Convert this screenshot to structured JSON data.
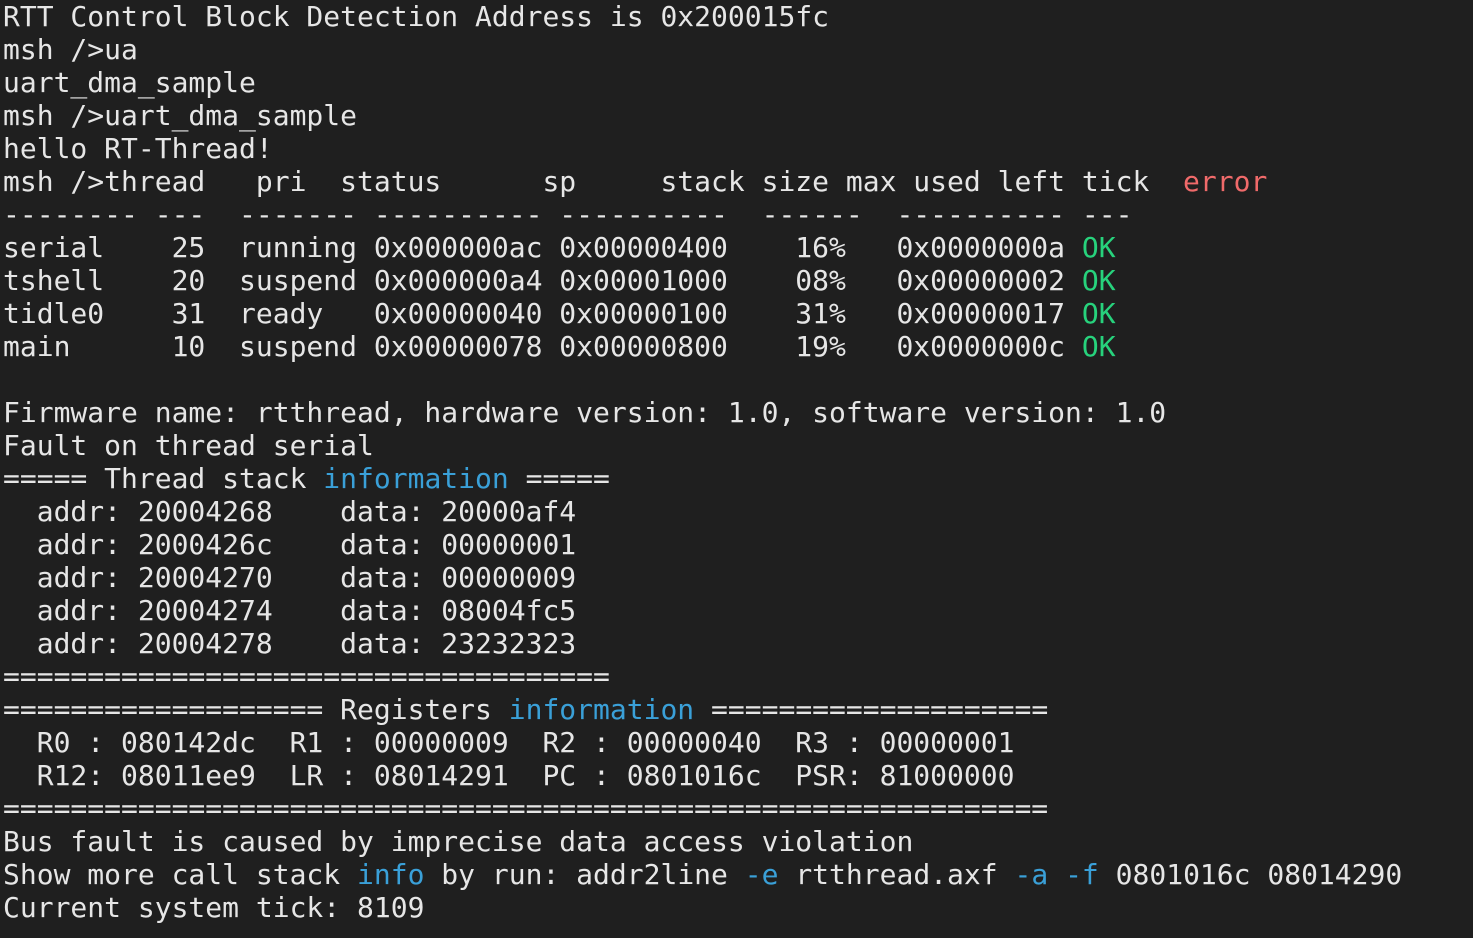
{
  "terminal": {
    "lines": [
      {
        "id": "rtt",
        "segments": [
          {
            "text": "RTT Control Block Detection Address is 0x200015fc",
            "color": "default"
          }
        ]
      },
      {
        "id": "cmd-ua",
        "segments": [
          {
            "text": "msh />ua",
            "color": "default"
          }
        ]
      },
      {
        "id": "complete-uart",
        "segments": [
          {
            "text": "uart_dma_sample",
            "color": "default"
          }
        ]
      },
      {
        "id": "cmd-uart",
        "segments": [
          {
            "text": "msh />uart_dma_sample",
            "color": "default"
          }
        ]
      },
      {
        "id": "hello",
        "segments": [
          {
            "text": "hello RT-Thread!",
            "color": "default"
          }
        ]
      },
      {
        "id": "thread-header",
        "segments": [
          {
            "text": "msh />thread   pri  status      sp     stack size max used left tick  ",
            "color": "default"
          },
          {
            "text": "error",
            "color": "red"
          }
        ]
      },
      {
        "id": "thread-separator",
        "segments": [
          {
            "text": "-------- ---  ------- ---------- ----------  ------  ---------- ---",
            "color": "default"
          }
        ]
      },
      {
        "id": "row-serial",
        "segments": [
          {
            "text": "serial    25  running 0x000000ac 0x00000400    16%   0x0000000a ",
            "color": "default"
          },
          {
            "text": "OK",
            "color": "green"
          }
        ]
      },
      {
        "id": "row-tshell",
        "segments": [
          {
            "text": "tshell    20  suspend 0x000000a4 0x00001000    08%   0x00000002 ",
            "color": "default"
          },
          {
            "text": "OK",
            "color": "green"
          }
        ]
      },
      {
        "id": "row-tidle0",
        "segments": [
          {
            "text": "tidle0    31  ready   0x00000040 0x00000100    31%   0x00000017 ",
            "color": "default"
          },
          {
            "text": "OK",
            "color": "green"
          }
        ]
      },
      {
        "id": "row-main",
        "segments": [
          {
            "text": "main      10  suspend 0x00000078 0x00000800    19%   0x0000000c ",
            "color": "default"
          },
          {
            "text": "OK",
            "color": "green"
          }
        ]
      },
      {
        "id": "blank",
        "segments": [
          {
            "text": "",
            "color": "default"
          }
        ]
      },
      {
        "id": "firmware",
        "segments": [
          {
            "text": "Firmware name: rtthread, hardware version: 1.0, software version: 1.0",
            "color": "default"
          }
        ]
      },
      {
        "id": "fault",
        "segments": [
          {
            "text": "Fault on thread serial",
            "color": "default"
          }
        ]
      },
      {
        "id": "stack-header",
        "segments": [
          {
            "text": "===== Thread stack ",
            "color": "default"
          },
          {
            "text": "information",
            "color": "blue"
          },
          {
            "text": " =====",
            "color": "default"
          }
        ]
      },
      {
        "id": "stack-1",
        "segments": [
          {
            "text": "  addr: 20004268    data: 20000af4",
            "color": "default"
          }
        ]
      },
      {
        "id": "stack-2",
        "segments": [
          {
            "text": "  addr: 2000426c    data: 00000001",
            "color": "default"
          }
        ]
      },
      {
        "id": "stack-3",
        "segments": [
          {
            "text": "  addr: 20004270    data: 00000009",
            "color": "default"
          }
        ]
      },
      {
        "id": "stack-4",
        "segments": [
          {
            "text": "  addr: 20004274    data: 08004fc5",
            "color": "default"
          }
        ]
      },
      {
        "id": "stack-5",
        "segments": [
          {
            "text": "  addr: 20004278    data: 23232323",
            "color": "default"
          }
        ]
      },
      {
        "id": "stack-footer",
        "segments": [
          {
            "text": "====================================",
            "color": "default"
          }
        ]
      },
      {
        "id": "reg-header",
        "segments": [
          {
            "text": "=================== Registers ",
            "color": "default"
          },
          {
            "text": "information",
            "color": "blue"
          },
          {
            "text": " ====================",
            "color": "default"
          }
        ]
      },
      {
        "id": "reg-1",
        "segments": [
          {
            "text": "  R0 : 080142dc  R1 : 00000009  R2 : 00000040  R3 : 00000001",
            "color": "default"
          }
        ]
      },
      {
        "id": "reg-2",
        "segments": [
          {
            "text": "  R12: 08011ee9  LR : 08014291  PC : 0801016c  PSR: 81000000",
            "color": "default"
          }
        ]
      },
      {
        "id": "reg-footer",
        "segments": [
          {
            "text": "==============================================================",
            "color": "default"
          }
        ]
      },
      {
        "id": "bus-fault",
        "segments": [
          {
            "text": "Bus fault is caused by imprecise data access violation",
            "color": "default"
          }
        ]
      },
      {
        "id": "show-more",
        "segments": [
          {
            "text": "Show more call stack ",
            "color": "default"
          },
          {
            "text": "info",
            "color": "blue"
          },
          {
            "text": " by run: addr2line ",
            "color": "default"
          },
          {
            "text": "-e",
            "color": "blue"
          },
          {
            "text": " rtthread.axf ",
            "color": "default"
          },
          {
            "text": "-a",
            "color": "blue"
          },
          {
            "text": " ",
            "color": "default"
          },
          {
            "text": "-f",
            "color": "blue"
          },
          {
            "text": " 0801016c 08014290",
            "color": "default"
          }
        ]
      },
      {
        "id": "tick",
        "segments": [
          {
            "text": "Current system tick: 8109",
            "color": "default"
          }
        ]
      }
    ]
  },
  "colors": {
    "background": "#1f1f1f",
    "default": "#e6e6e6",
    "blue": "#3aa0d8",
    "green": "#27d27c",
    "red": "#f06a6a"
  }
}
